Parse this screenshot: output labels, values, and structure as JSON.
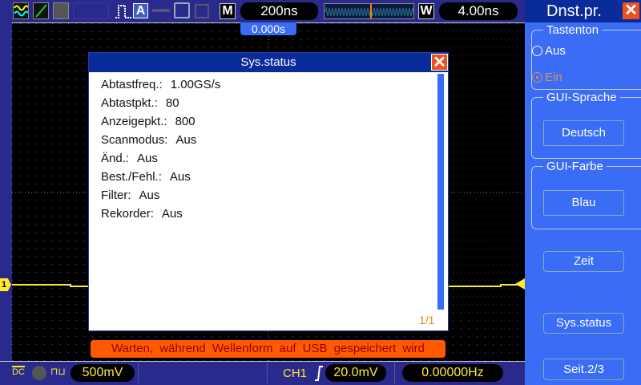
{
  "topbar": {
    "timebase": "200ns",
    "trigger_pos": "0.000s",
    "window_label": "W",
    "window_time": "4.00ns",
    "menu_label": "M"
  },
  "dialog": {
    "title": "Sys.status",
    "rows": [
      {
        "label": "Abtastfreq.:",
        "value": "1.00GS/s"
      },
      {
        "label": "Abtastpkt.:",
        "value": "80"
      },
      {
        "label": "Anzeigepkt.:",
        "value": "800"
      },
      {
        "label": "Scanmodus:",
        "value": "Aus"
      },
      {
        "label": "Änd.:",
        "value": "Aus"
      },
      {
        "label": "Best./Fehl.:",
        "value": "Aus"
      },
      {
        "label": "Filter:",
        "value": "Aus"
      },
      {
        "label": "Rekorder:",
        "value": "Aus"
      }
    ],
    "page": "1/1"
  },
  "message": "Warten, während Wellenform auf USB gespeichert wird",
  "bottombar": {
    "coupling": "DC",
    "ch1_scale": "500mV",
    "trigger_source": "CH1",
    "trigger_level": "20.0mV",
    "frequency": "0.00000Hz",
    "channel_marker": "1"
  },
  "panel": {
    "title": "Dnst.pr.",
    "tastenton": {
      "legend": "Tastenton",
      "options": [
        "Aus",
        "Ein"
      ],
      "selected": "Ein"
    },
    "sprache": {
      "legend": "GUI-Sprache",
      "value": "Deutsch"
    },
    "farbe": {
      "legend": "GUI-Farbe",
      "value": "Blau"
    },
    "buttons": [
      "Zeit",
      "Sys.status",
      "Seit.2/3"
    ]
  },
  "colors": {
    "trace": "#ffea30",
    "accent_orange": "#ff5a00",
    "panel": "#3a6cf5"
  }
}
